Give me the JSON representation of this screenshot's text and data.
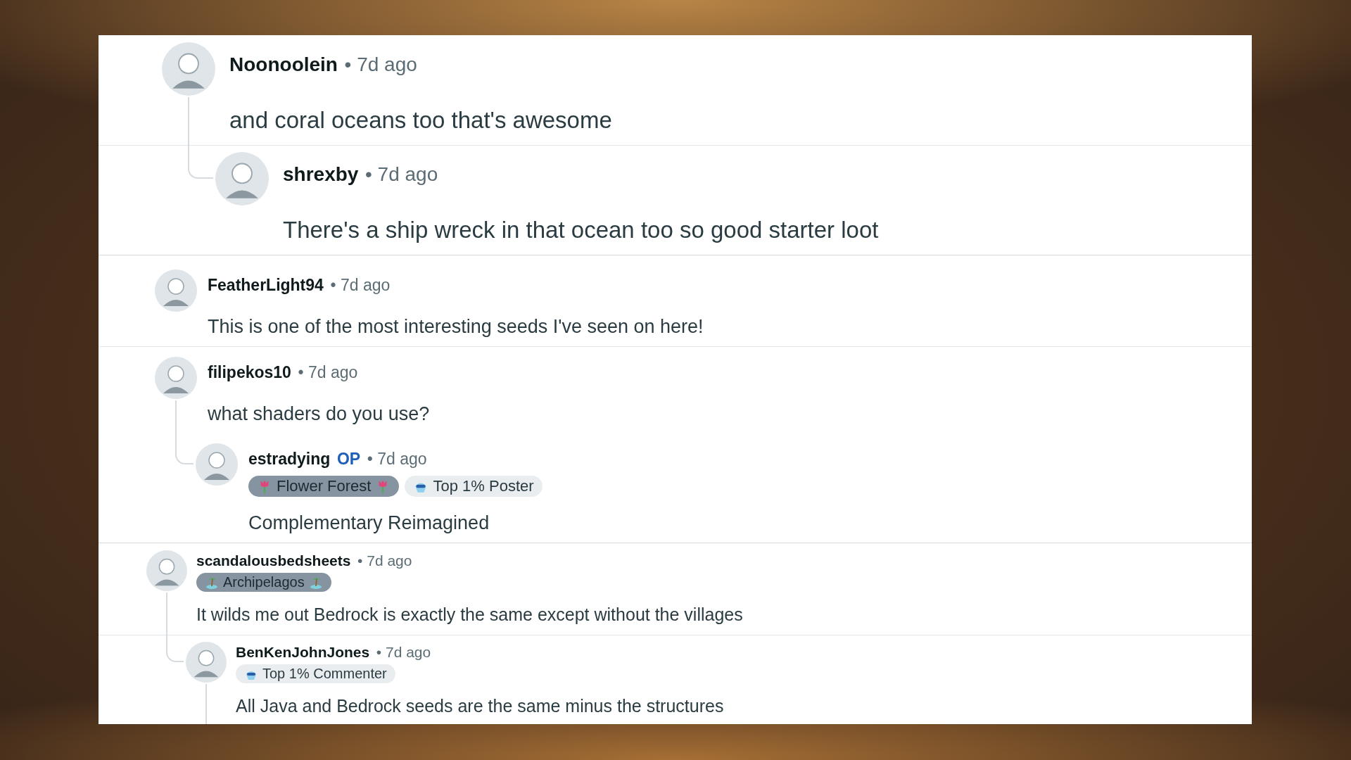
{
  "sections": [
    {
      "comments": [
        {
          "author": "Noonoolein",
          "time": "• 7d ago",
          "body": "and coral oceans too that's awesome",
          "replies": [
            {
              "author": "shrexby",
              "time": "• 7d ago",
              "body": "There's a ship wreck in that ocean too so good starter loot",
              "divider": true
            }
          ]
        }
      ]
    },
    {
      "comments": [
        {
          "author": "FeatherLight94",
          "time": "• 7d ago",
          "body": "This is one of the most interesting seeds I've seen on here!"
        },
        {
          "author": "filipekos10",
          "time": "• 7d ago",
          "body": "what shaders do you use?",
          "replies": [
            {
              "author": "estradying",
              "badge": "OP",
              "time": "• 7d ago",
              "flairs": [
                {
                  "kind": "flower",
                  "text": "Flower Forest"
                },
                {
                  "kind": "achievement",
                  "text": "Top 1% Poster"
                }
              ],
              "body": "Complementary Reimagined",
              "divider": false
            }
          ]
        }
      ]
    },
    {
      "comments": [
        {
          "author": "scandalousbedsheets",
          "time": "• 7d ago",
          "flairs": [
            {
              "kind": "island",
              "text": "Archipelagos"
            }
          ],
          "body": "It wilds me out Bedrock is exactly the same except without the villages",
          "replies": [
            {
              "author": "BenKenJohnJones",
              "time": "• 7d ago",
              "flairs": [
                {
                  "kind": "achievement",
                  "text": "Top 1% Commenter"
                }
              ],
              "body": "All Java and Bedrock seeds are the same minus the structures",
              "divider": true,
              "continues": true
            }
          ]
        }
      ]
    }
  ]
}
